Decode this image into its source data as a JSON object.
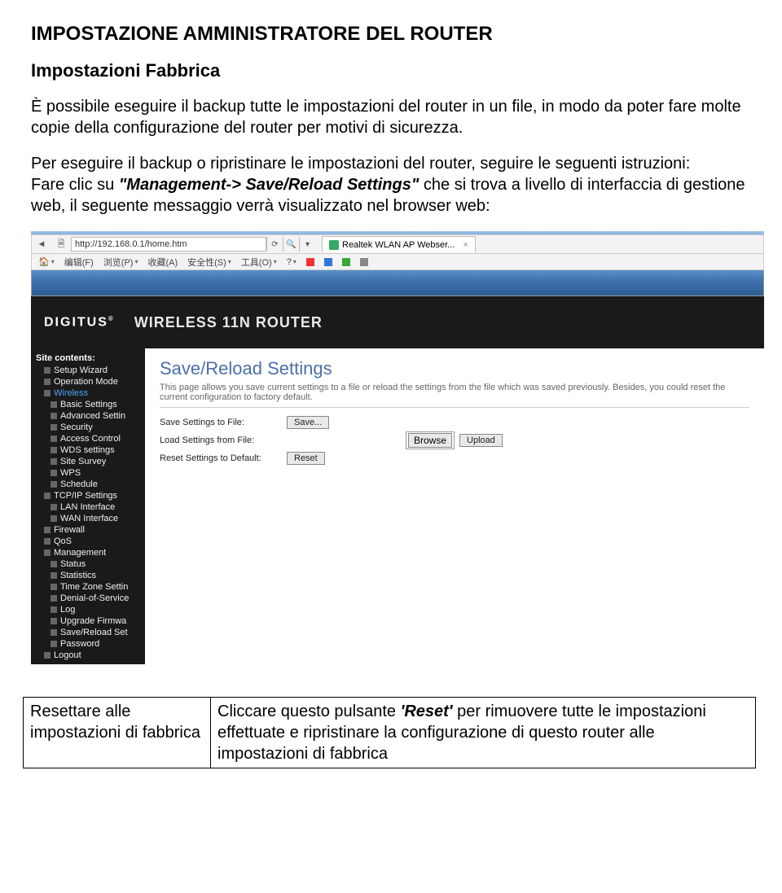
{
  "doc": {
    "title": "IMPOSTAZIONE AMMINISTRATORE DEL ROUTER",
    "subtitle": "Impostazioni Fabbrica",
    "p1": "È possibile eseguire il backup tutte le impostazioni del router in un file, in modo da poter fare molte copie della configurazione del router per motivi di sicurezza.",
    "p2a": "Per eseguire il backup o ripristinare le impostazioni del router, seguire le seguenti istruzioni:",
    "p2b_pre": "Fare clic su ",
    "p2b_quote": "\"Management-> Save/Reload Settings\"",
    "p2b_post": " che si trova a livello di interfaccia di gestione web, il seguente messaggio verrà visualizzato nel browser web:"
  },
  "browser": {
    "url": "http://192.168.0.1/home.htm",
    "tab": "Realtek WLAN AP Webser...",
    "cn_items": [
      "编辑(F)",
      "浏览(P)",
      "收藏(A)",
      "安全性(S)",
      "工具(O)",
      "?"
    ]
  },
  "router": {
    "brand": "DIGITUS",
    "banner": "WIRELESS 11N ROUTER",
    "sidebar_head": "Site contents:",
    "sidebar": [
      {
        "label": "Setup Wizard",
        "lvl": 1
      },
      {
        "label": "Operation Mode",
        "lvl": 1
      },
      {
        "label": "Wireless",
        "lvl": 1,
        "sel": true
      },
      {
        "label": "Basic Settings",
        "lvl": 2
      },
      {
        "label": "Advanced Settin",
        "lvl": 2
      },
      {
        "label": "Security",
        "lvl": 2
      },
      {
        "label": "Access Control",
        "lvl": 2
      },
      {
        "label": "WDS settings",
        "lvl": 2
      },
      {
        "label": "Site Survey",
        "lvl": 2
      },
      {
        "label": "WPS",
        "lvl": 2
      },
      {
        "label": "Schedule",
        "lvl": 2
      },
      {
        "label": "TCP/IP Settings",
        "lvl": 1
      },
      {
        "label": "LAN Interface",
        "lvl": 2
      },
      {
        "label": "WAN Interface",
        "lvl": 2
      },
      {
        "label": "Firewall",
        "lvl": 1
      },
      {
        "label": "QoS",
        "lvl": 1
      },
      {
        "label": "Management",
        "lvl": 1
      },
      {
        "label": "Status",
        "lvl": 2
      },
      {
        "label": "Statistics",
        "lvl": 2
      },
      {
        "label": "Time Zone Settin",
        "lvl": 2
      },
      {
        "label": "Denial-of-Service",
        "lvl": 2
      },
      {
        "label": "Log",
        "lvl": 2
      },
      {
        "label": "Upgrade Firmwa",
        "lvl": 2
      },
      {
        "label": "Save/Reload Set",
        "lvl": 2
      },
      {
        "label": "Password",
        "lvl": 2
      },
      {
        "label": "Logout",
        "lvl": 1
      }
    ],
    "page": {
      "title": "Save/Reload Settings",
      "desc": "This page allows you save current settings to a file or reload the settings from the file which was saved previously. Besides, you could reset the current configuration to factory default.",
      "row1_label": "Save Settings to File:",
      "row1_btn": "Save...",
      "row2_label": "Load Settings from File:",
      "row2_browse": "Browse",
      "row2_upload": "Upload",
      "row3_label": "Reset Settings to Default:",
      "row3_btn": "Reset"
    }
  },
  "table": {
    "left": "Resettare alle impostazioni di fabbrica",
    "right_a": "Cliccare questo pulsante ",
    "right_b": "'Reset'",
    "right_c": " per rimuovere tutte le impostazioni effettuate e ripristinare la configurazione di questo router alle impostazioni di fabbrica"
  }
}
